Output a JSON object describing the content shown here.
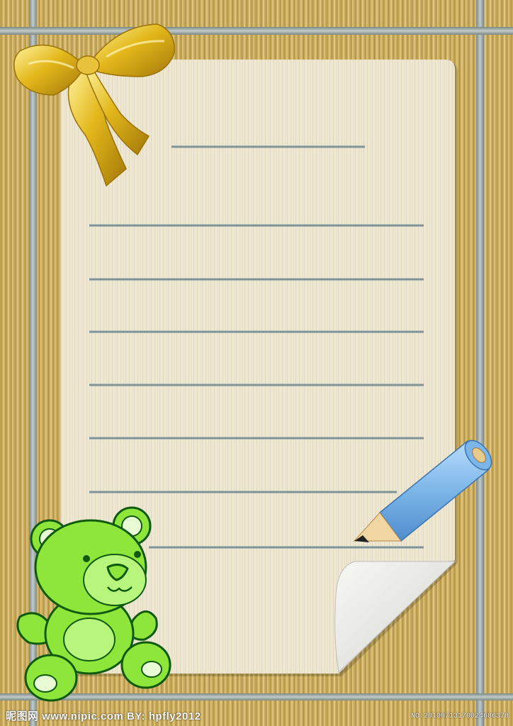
{
  "artwork": {
    "subject": "stationery-letter-template",
    "colors": {
      "wood_base": "#c9a95a",
      "wood_dark": "#9c7a2e",
      "wood_light": "#e6d19a",
      "frame_bar": "#9aa6a2",
      "paper": "#eee7d3",
      "paper_grain": "#d8cca8",
      "writing_line": "#7f9498",
      "ribbon": "#e0b418",
      "bear": "#8ee63a",
      "pencil": "#7cb6e8"
    },
    "lines": {
      "count": 8
    }
  },
  "watermark": {
    "left_text": "昵图网 www.nipic.com  BY: hpfly2012",
    "right_text": "NO:20100713170024686378"
  }
}
